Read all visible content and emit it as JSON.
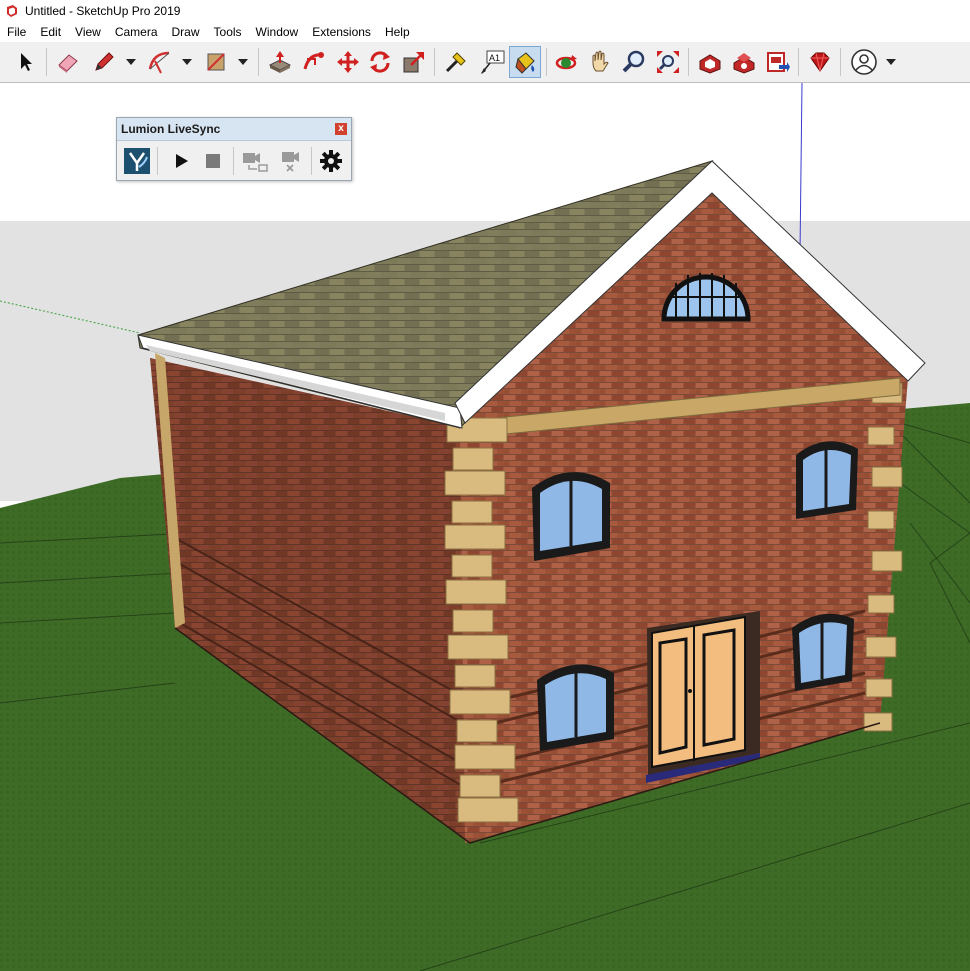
{
  "window": {
    "title": "Untitled - SketchUp Pro 2019"
  },
  "menu": [
    "File",
    "Edit",
    "View",
    "Camera",
    "Draw",
    "Tools",
    "Window",
    "Extensions",
    "Help"
  ],
  "toolbar": {
    "tools": [
      "select-icon",
      "eraser-icon",
      "pencil-icon",
      "arc-icon",
      "rectangle-icon",
      "push-pull-icon",
      "follow-me-icon",
      "move-icon",
      "rotate-icon",
      "scale-icon",
      "tape-measure-icon",
      "text-icon",
      "paint-bucket-icon",
      "orbit-icon",
      "pan-icon",
      "zoom-icon",
      "zoom-extents-icon",
      "warehouse-icon",
      "extension-warehouse-icon",
      "send-to-layout-icon",
      "ruby-icon",
      "account-icon"
    ],
    "active_tool": "paint-bucket-icon",
    "text_tool_label": "A1"
  },
  "livesync": {
    "title": "Lumion LiveSync",
    "close_label": "x",
    "tools": [
      "lumion-logo-icon",
      "play-icon",
      "stop-icon",
      "sync-camera-icon",
      "stop-camera-sync-icon",
      "settings-icon"
    ]
  },
  "scene": {
    "sky_color": "#ffffff",
    "ground_color": "#3d6b26",
    "brick_color": "#9a4f32",
    "roof_color": "#7c7858",
    "glass_color": "#8ab4e4",
    "door_color": "#f3bd80"
  }
}
